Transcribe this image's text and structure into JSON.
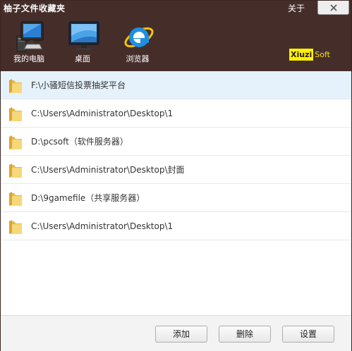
{
  "window": {
    "title": "柚子文件收藏夹",
    "about_label": "关于"
  },
  "nav": [
    {
      "label": "我的电脑",
      "icon": "computer-icon"
    },
    {
      "label": "桌面",
      "icon": "desktop-icon"
    },
    {
      "label": "浏览器",
      "icon": "ie-browser-icon"
    }
  ],
  "brand": {
    "part1": "Xiuzi",
    "part2": "Soft"
  },
  "favorites": [
    {
      "path": "F:\\小骚短信投票抽奖平台",
      "selected": true
    },
    {
      "path": "C:\\Users\\Administrator\\Desktop\\1",
      "selected": false
    },
    {
      "path": "D:\\pcsoft（软件服务器）",
      "selected": false
    },
    {
      "path": "C:\\Users\\Administrator\\Desktop\\封面",
      "selected": false
    },
    {
      "path": "D:\\9gamefile（共享服务器）",
      "selected": false
    },
    {
      "path": "C:\\Users\\Administrator\\Desktop\\1",
      "selected": false
    }
  ],
  "buttons": {
    "add_label": "添加",
    "delete_label": "删除",
    "settings_label": "设置"
  },
  "colors": {
    "header_bg": "#452e2a",
    "selected_row_bg": "#e5f1fb",
    "brand_yellow": "#fff200"
  }
}
